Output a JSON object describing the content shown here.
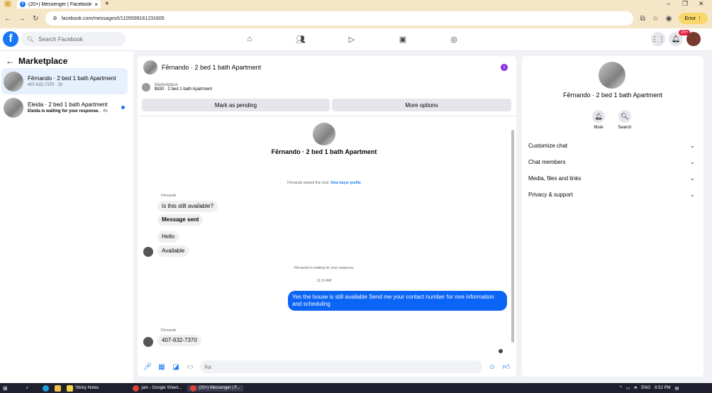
{
  "browser": {
    "tab_title": "(20+) Messenger | Facebook",
    "tab_close": "×",
    "new_tab": "+",
    "url": "facebook.com/messages/t/1105599161231605",
    "error_label": "Error",
    "minimize": "–",
    "maximize": "❐",
    "close": "✕"
  },
  "fbnav": {
    "logo": "f",
    "search_placeholder": "Search Facebook",
    "notif_badge": "20+"
  },
  "left": {
    "title": "Marketplace",
    "conversations": [
      {
        "name": "Fērnando · 2 bed 1 bath Apartment",
        "sub": "407-632-7370 · 2h",
        "active": true
      },
      {
        "name": "Eleida · 2 bed 1 bath Apartment",
        "sub_bold": "Eleida is waiting for your response.",
        "sub": " · 6h",
        "active": false
      }
    ]
  },
  "chat": {
    "header_name": "Fērnando · 2 bed 1 bath Apartment",
    "marketplace_label": "Marketplace",
    "listing": "$830 · 2 bed 1 bath Apartment",
    "mark_pending": "Mark as pending",
    "more_options": "More options",
    "center_name": "Fērnando · 2 bed 1 bath Apartment",
    "started_text": "Fērnando started this chat.",
    "view_buyer": "View buyer profile",
    "sender1": "Fērnando",
    "msg1": "Is this still available?",
    "msg2": "Message sent",
    "msg3": "Hello",
    "msg4": "Available",
    "waiting_text": "Fērnando is waiting for your response.",
    "time": "11:10 AM",
    "outgoing": "Yes the house is still available  Send me your contact number for mre information and  scheduling",
    "sender2": "Fērnando",
    "msg5": "407-632-7370",
    "input_placeholder": "Aa"
  },
  "right": {
    "name": "Fērnando · 2 bed 1 bath Apartment",
    "mute": "Mute",
    "search": "Search",
    "sections": [
      "Customize chat",
      "Chat members",
      "Media, files and links",
      "Privacy & support"
    ]
  },
  "taskbar": {
    "sticky": "Sticky Notes",
    "sheets": "jam - Google Sheet...",
    "messenger": "(20+) Messenger | F...",
    "lang": "ENG",
    "time": "6:52 PM"
  }
}
